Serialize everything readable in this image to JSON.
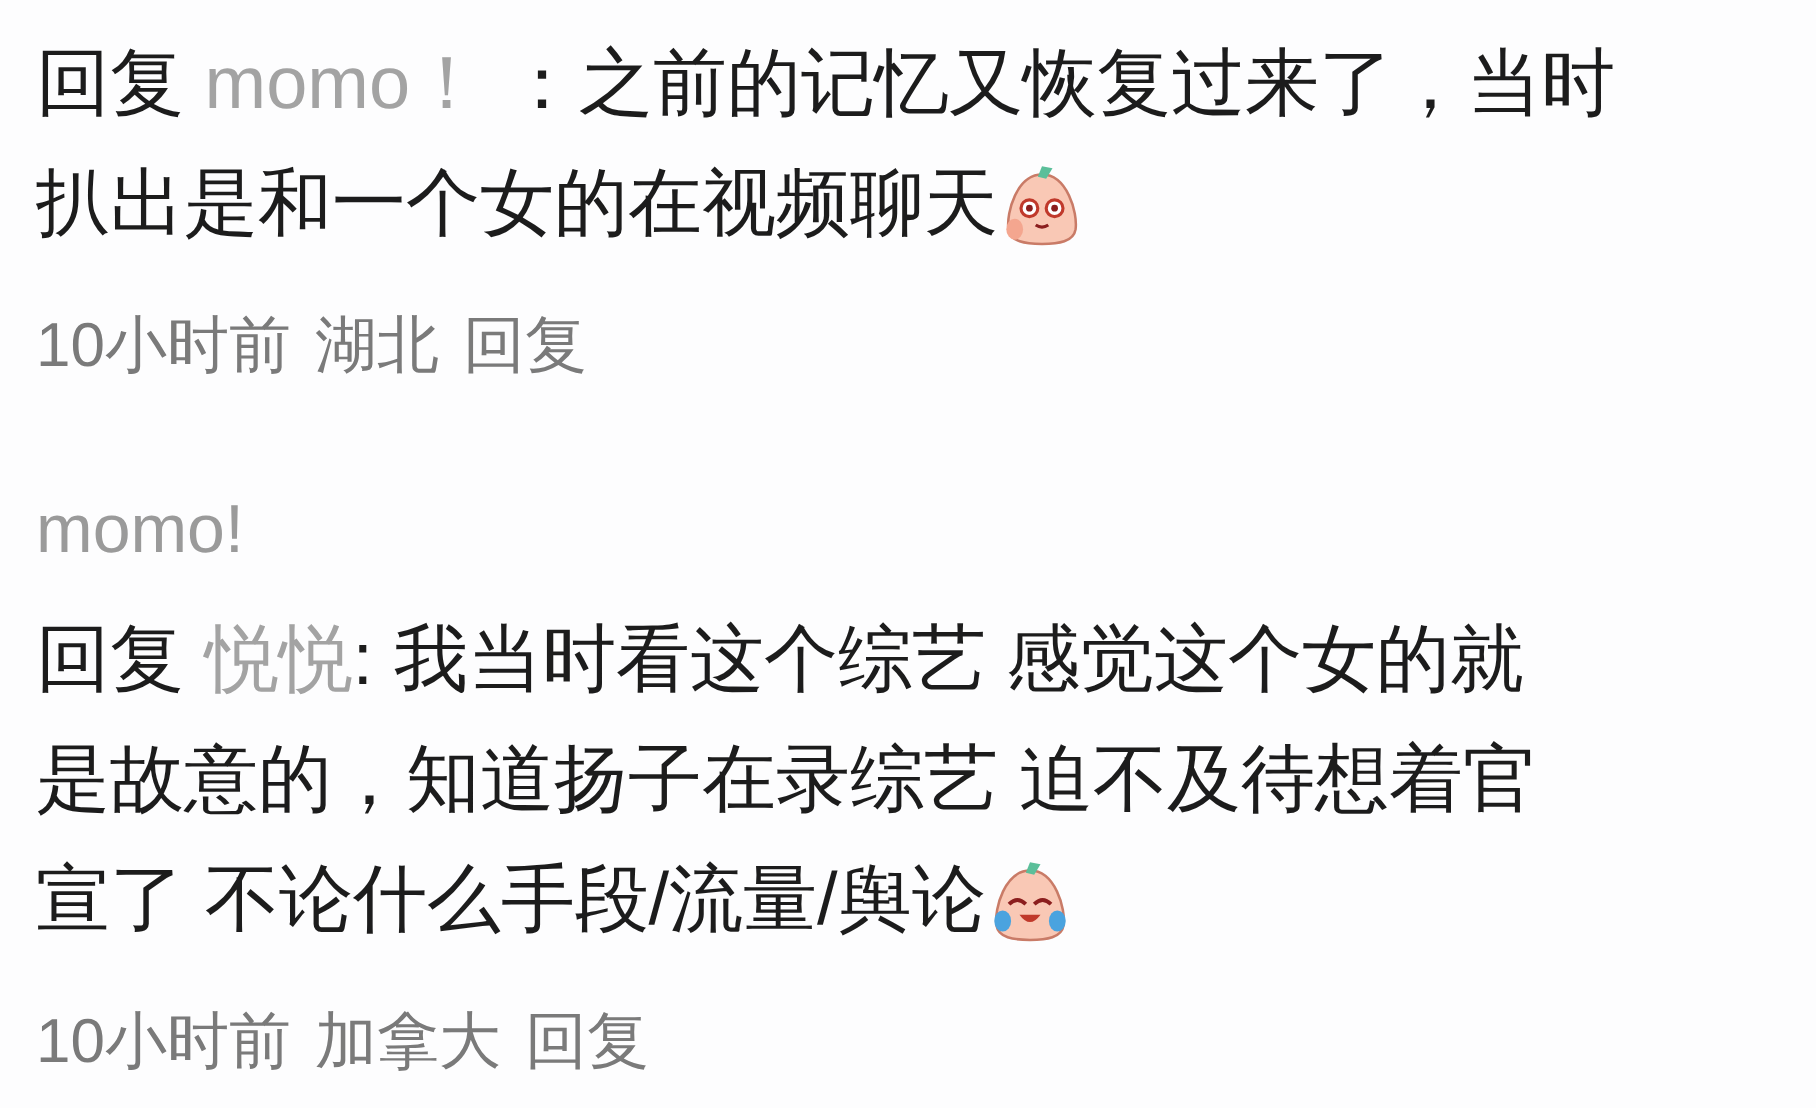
{
  "comments": [
    {
      "reply_label": "回复",
      "reply_to": "momo！",
      "lines": [
        " ：之前的记忆又恢复过来了，当时",
        "扒出是和一个女的在视频聊天"
      ],
      "emoji": {
        "kind": "blush"
      },
      "meta": {
        "time": "10小时前",
        "location": "湖北",
        "reply": "回复"
      }
    },
    {
      "author": "momo!",
      "reply_label": "回复",
      "reply_to": "悦悦",
      "lines": [
        ": 我当时看这个综艺 感觉这个女的就",
        "是故意的，知道扬子在录综艺 迫不及待想着官",
        "宣了 不论什么手段/流量/舆论"
      ],
      "emoji": {
        "kind": "crying-laugh"
      },
      "meta": {
        "time": "10小时前",
        "location": "加拿大",
        "reply": "回复"
      }
    }
  ]
}
